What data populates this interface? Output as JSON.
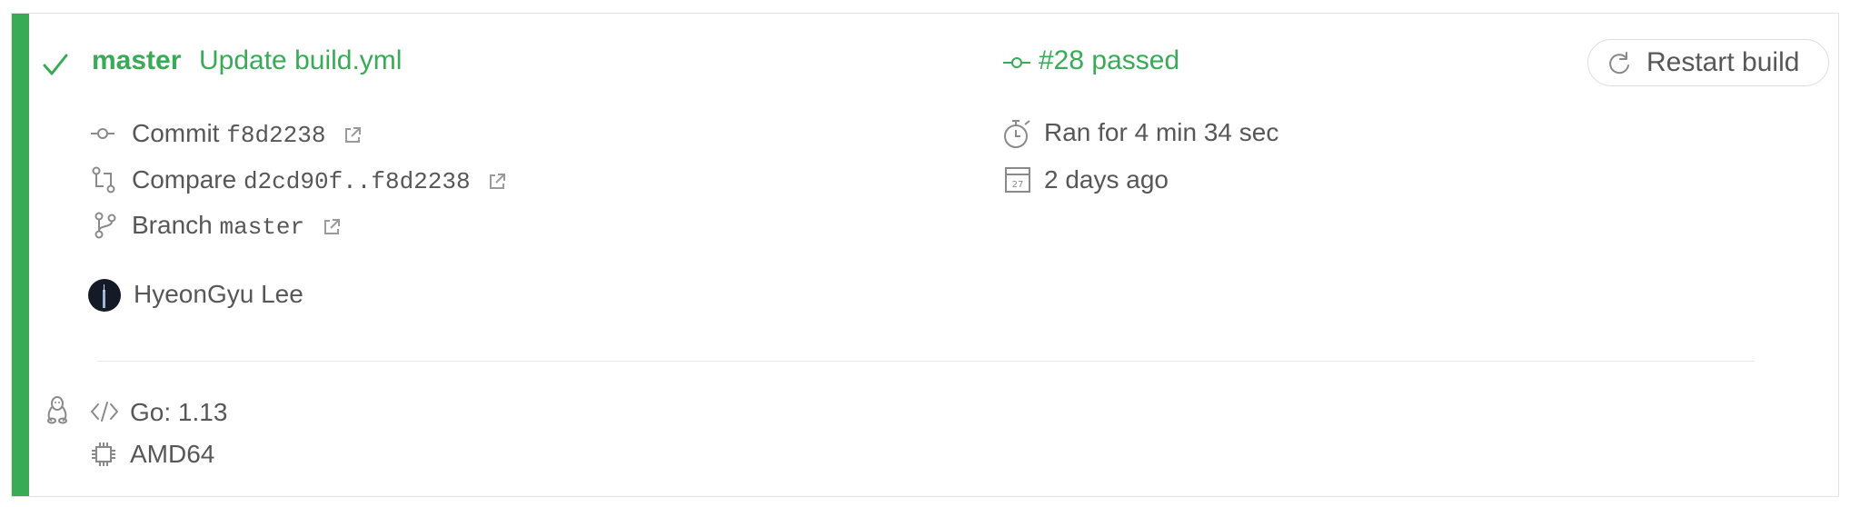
{
  "build": {
    "branch": "master",
    "message": "Update build.yml",
    "number_status": "#28 passed",
    "restart_label": "Restart build",
    "status_color": "#39aa56"
  },
  "details": {
    "commit_label": "Commit",
    "commit_hash": "f8d2238",
    "compare_label": "Compare",
    "compare_range": "d2cd90f..f8d2238",
    "branch_label": "Branch",
    "branch_name": "master",
    "author": "HyeonGyu Lee",
    "duration": "Ran for 4 min 34 sec",
    "finished": "2 days ago",
    "calendar_day": "27"
  },
  "job": {
    "language": "Go: 1.13",
    "arch": "AMD64",
    "os_icon": "linux-icon"
  },
  "icons": {
    "status": "check-icon",
    "commit": "commit-icon",
    "compare": "compare-icon",
    "branch": "branch-icon",
    "external": "external-link-icon",
    "timer": "stopwatch-icon",
    "calendar": "calendar-icon",
    "restart": "restart-icon",
    "code": "code-icon",
    "cpu": "cpu-icon"
  }
}
